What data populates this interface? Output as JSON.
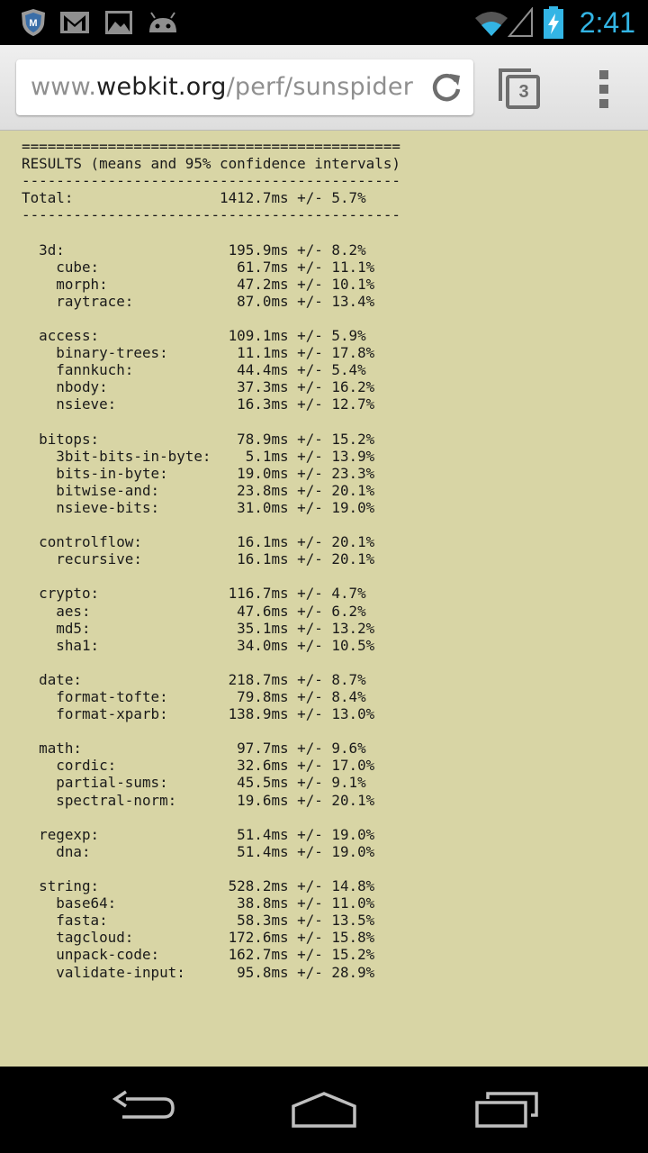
{
  "status_bar": {
    "time": "2:41",
    "notification_icons": [
      "antivirus-shield-icon",
      "gmail-icon",
      "gallery-picture-icon",
      "android-debug-icon"
    ],
    "status_icons": [
      "wifi-icon",
      "cell-signal-icon",
      "battery-charging-icon"
    ],
    "accent_color": "#33b5e5"
  },
  "browser": {
    "url_prefix": "www.",
    "url_host": "webkit.org",
    "url_path": "/perf/sunspider",
    "tab_count": "3"
  },
  "page": {
    "background": "#d8d5a5",
    "lines": [
      "============================================",
      "RESULTS (means and 95% confidence intervals)",
      "--------------------------------------------",
      "Total:                 1412.7ms +/- 5.7%",
      "--------------------------------------------",
      "",
      "  3d:                   195.9ms +/- 8.2%",
      "    cube:                61.7ms +/- 11.1%",
      "    morph:               47.2ms +/- 10.1%",
      "    raytrace:            87.0ms +/- 13.4%",
      "",
      "  access:               109.1ms +/- 5.9%",
      "    binary-trees:        11.1ms +/- 17.8%",
      "    fannkuch:            44.4ms +/- 5.4%",
      "    nbody:               37.3ms +/- 16.2%",
      "    nsieve:              16.3ms +/- 12.7%",
      "",
      "  bitops:                78.9ms +/- 15.2%",
      "    3bit-bits-in-byte:    5.1ms +/- 13.9%",
      "    bits-in-byte:        19.0ms +/- 23.3%",
      "    bitwise-and:         23.8ms +/- 20.1%",
      "    nsieve-bits:         31.0ms +/- 19.0%",
      "",
      "  controlflow:           16.1ms +/- 20.1%",
      "    recursive:           16.1ms +/- 20.1%",
      "",
      "  crypto:               116.7ms +/- 4.7%",
      "    aes:                 47.6ms +/- 6.2%",
      "    md5:                 35.1ms +/- 13.2%",
      "    sha1:                34.0ms +/- 10.5%",
      "",
      "  date:                 218.7ms +/- 8.7%",
      "    format-tofte:        79.8ms +/- 8.4%",
      "    format-xparb:       138.9ms +/- 13.0%",
      "",
      "  math:                  97.7ms +/- 9.6%",
      "    cordic:              32.6ms +/- 17.0%",
      "    partial-sums:        45.5ms +/- 9.1%",
      "    spectral-norm:       19.6ms +/- 20.1%",
      "",
      "  regexp:                51.4ms +/- 19.0%",
      "    dna:                 51.4ms +/- 19.0%",
      "",
      "  string:               528.2ms +/- 14.8%",
      "    base64:              38.8ms +/- 11.0%",
      "    fasta:               58.3ms +/- 13.5%",
      "    tagcloud:           172.6ms +/- 15.8%",
      "    unpack-code:        162.7ms +/- 15.2%",
      "    validate-input:      95.8ms +/- 28.9%"
    ]
  },
  "nav_bar": {
    "buttons": [
      "back-icon",
      "home-icon",
      "recent-apps-icon"
    ]
  }
}
